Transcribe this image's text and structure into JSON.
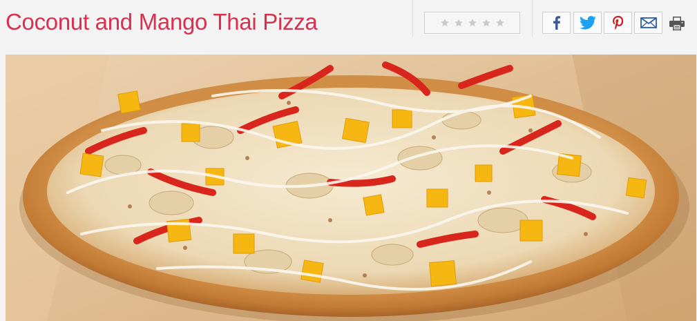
{
  "recipe": {
    "title": "Coconut and Mango Thai Pizza"
  },
  "rating": {
    "stars_total": 5,
    "stars_filled": 0
  },
  "share": {
    "facebook_icon": "facebook-icon",
    "twitter_icon": "twitter-icon",
    "pinterest_icon": "pinterest-icon",
    "email_icon": "email-icon",
    "print_icon": "print-icon"
  },
  "colors": {
    "title": "#d8304f",
    "facebook": "#3b5998",
    "twitter": "#1da1f2",
    "pinterest": "#cb2027",
    "email": "#2a5db0",
    "star_empty": "#c8c8c8"
  },
  "hero_image": {
    "subject": "pizza-photo"
  }
}
